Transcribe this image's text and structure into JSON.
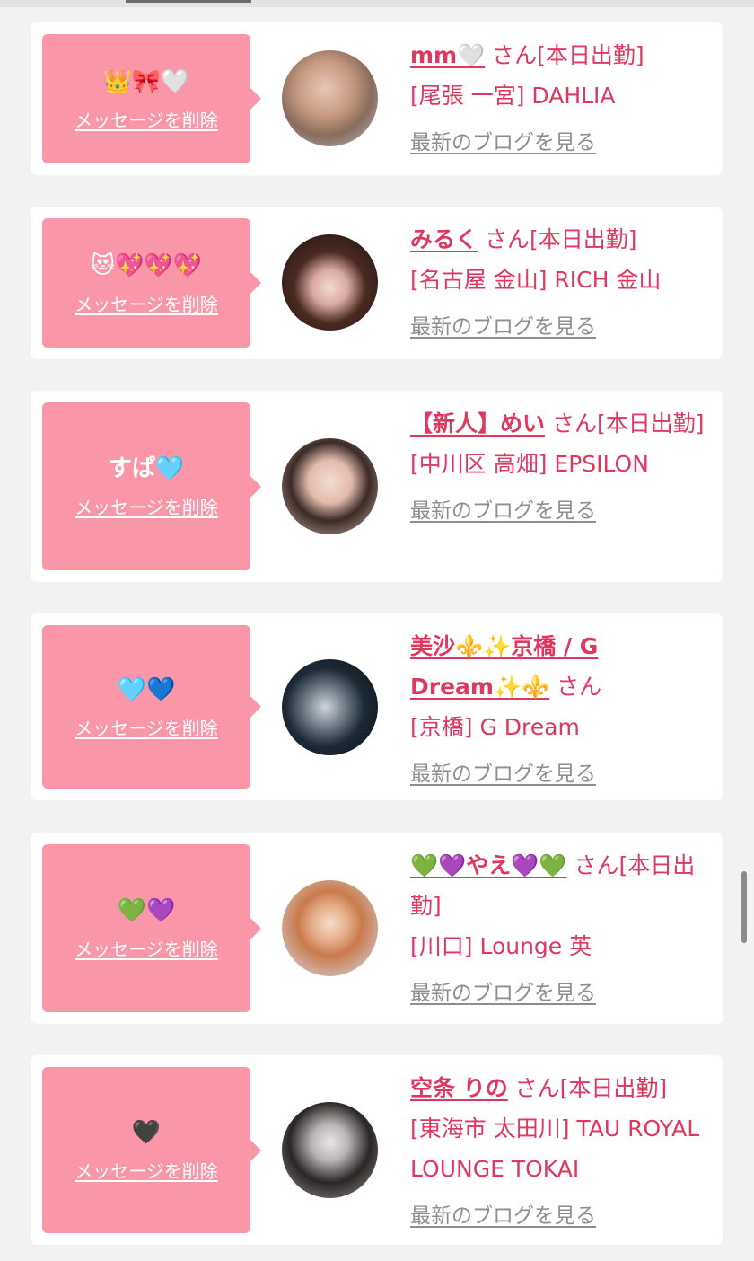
{
  "colors": {
    "accent": "#e0375f",
    "bubble": "#f997a8",
    "muted_link": "#8e8e8e",
    "background": "#f2f2f2"
  },
  "cards": [
    {
      "message": "👑🎀🤍",
      "delete_label": "メッセージを削除",
      "name": "mm🤍",
      "status": " さん[本日出勤]",
      "location": "[尾張 一宮] DAHLIA",
      "blog_label": "最新のブログを見る"
    },
    {
      "message": "😻💖💖💖",
      "delete_label": "メッセージを削除",
      "name": "みるく",
      "status": " さん[本日出勤]",
      "location": "[名古屋 金山] RICH 金山",
      "blog_label": "最新のブログを見る"
    },
    {
      "message": "すぱ🩵",
      "delete_label": "メッセージを削除",
      "name": "【新人】めい",
      "status": " さん[本日出勤]",
      "location": "[中川区 高畑] EPSILON",
      "blog_label": "最新のブログを見る"
    },
    {
      "message": "🩵💙",
      "delete_label": "メッセージを削除",
      "name": "美沙⚜️✨京橋 / G Dream✨⚜️",
      "status": " さん",
      "location": "[京橋] G Dream",
      "blog_label": "最新のブログを見る"
    },
    {
      "message": "💚💜",
      "delete_label": "メッセージを削除",
      "name": "💚💜やえ💜💚",
      "status": " さん[本日出勤]",
      "location": "[川口] Lounge 英",
      "blog_label": "最新のブログを見る"
    },
    {
      "message": "🖤",
      "delete_label": "メッセージを削除",
      "name": "空条 りの",
      "status": " さん[本日出勤]",
      "location": "[東海市 太田川] TAU ROYAL LOUNGE TOKAI",
      "blog_label": "最新のブログを見る"
    }
  ]
}
